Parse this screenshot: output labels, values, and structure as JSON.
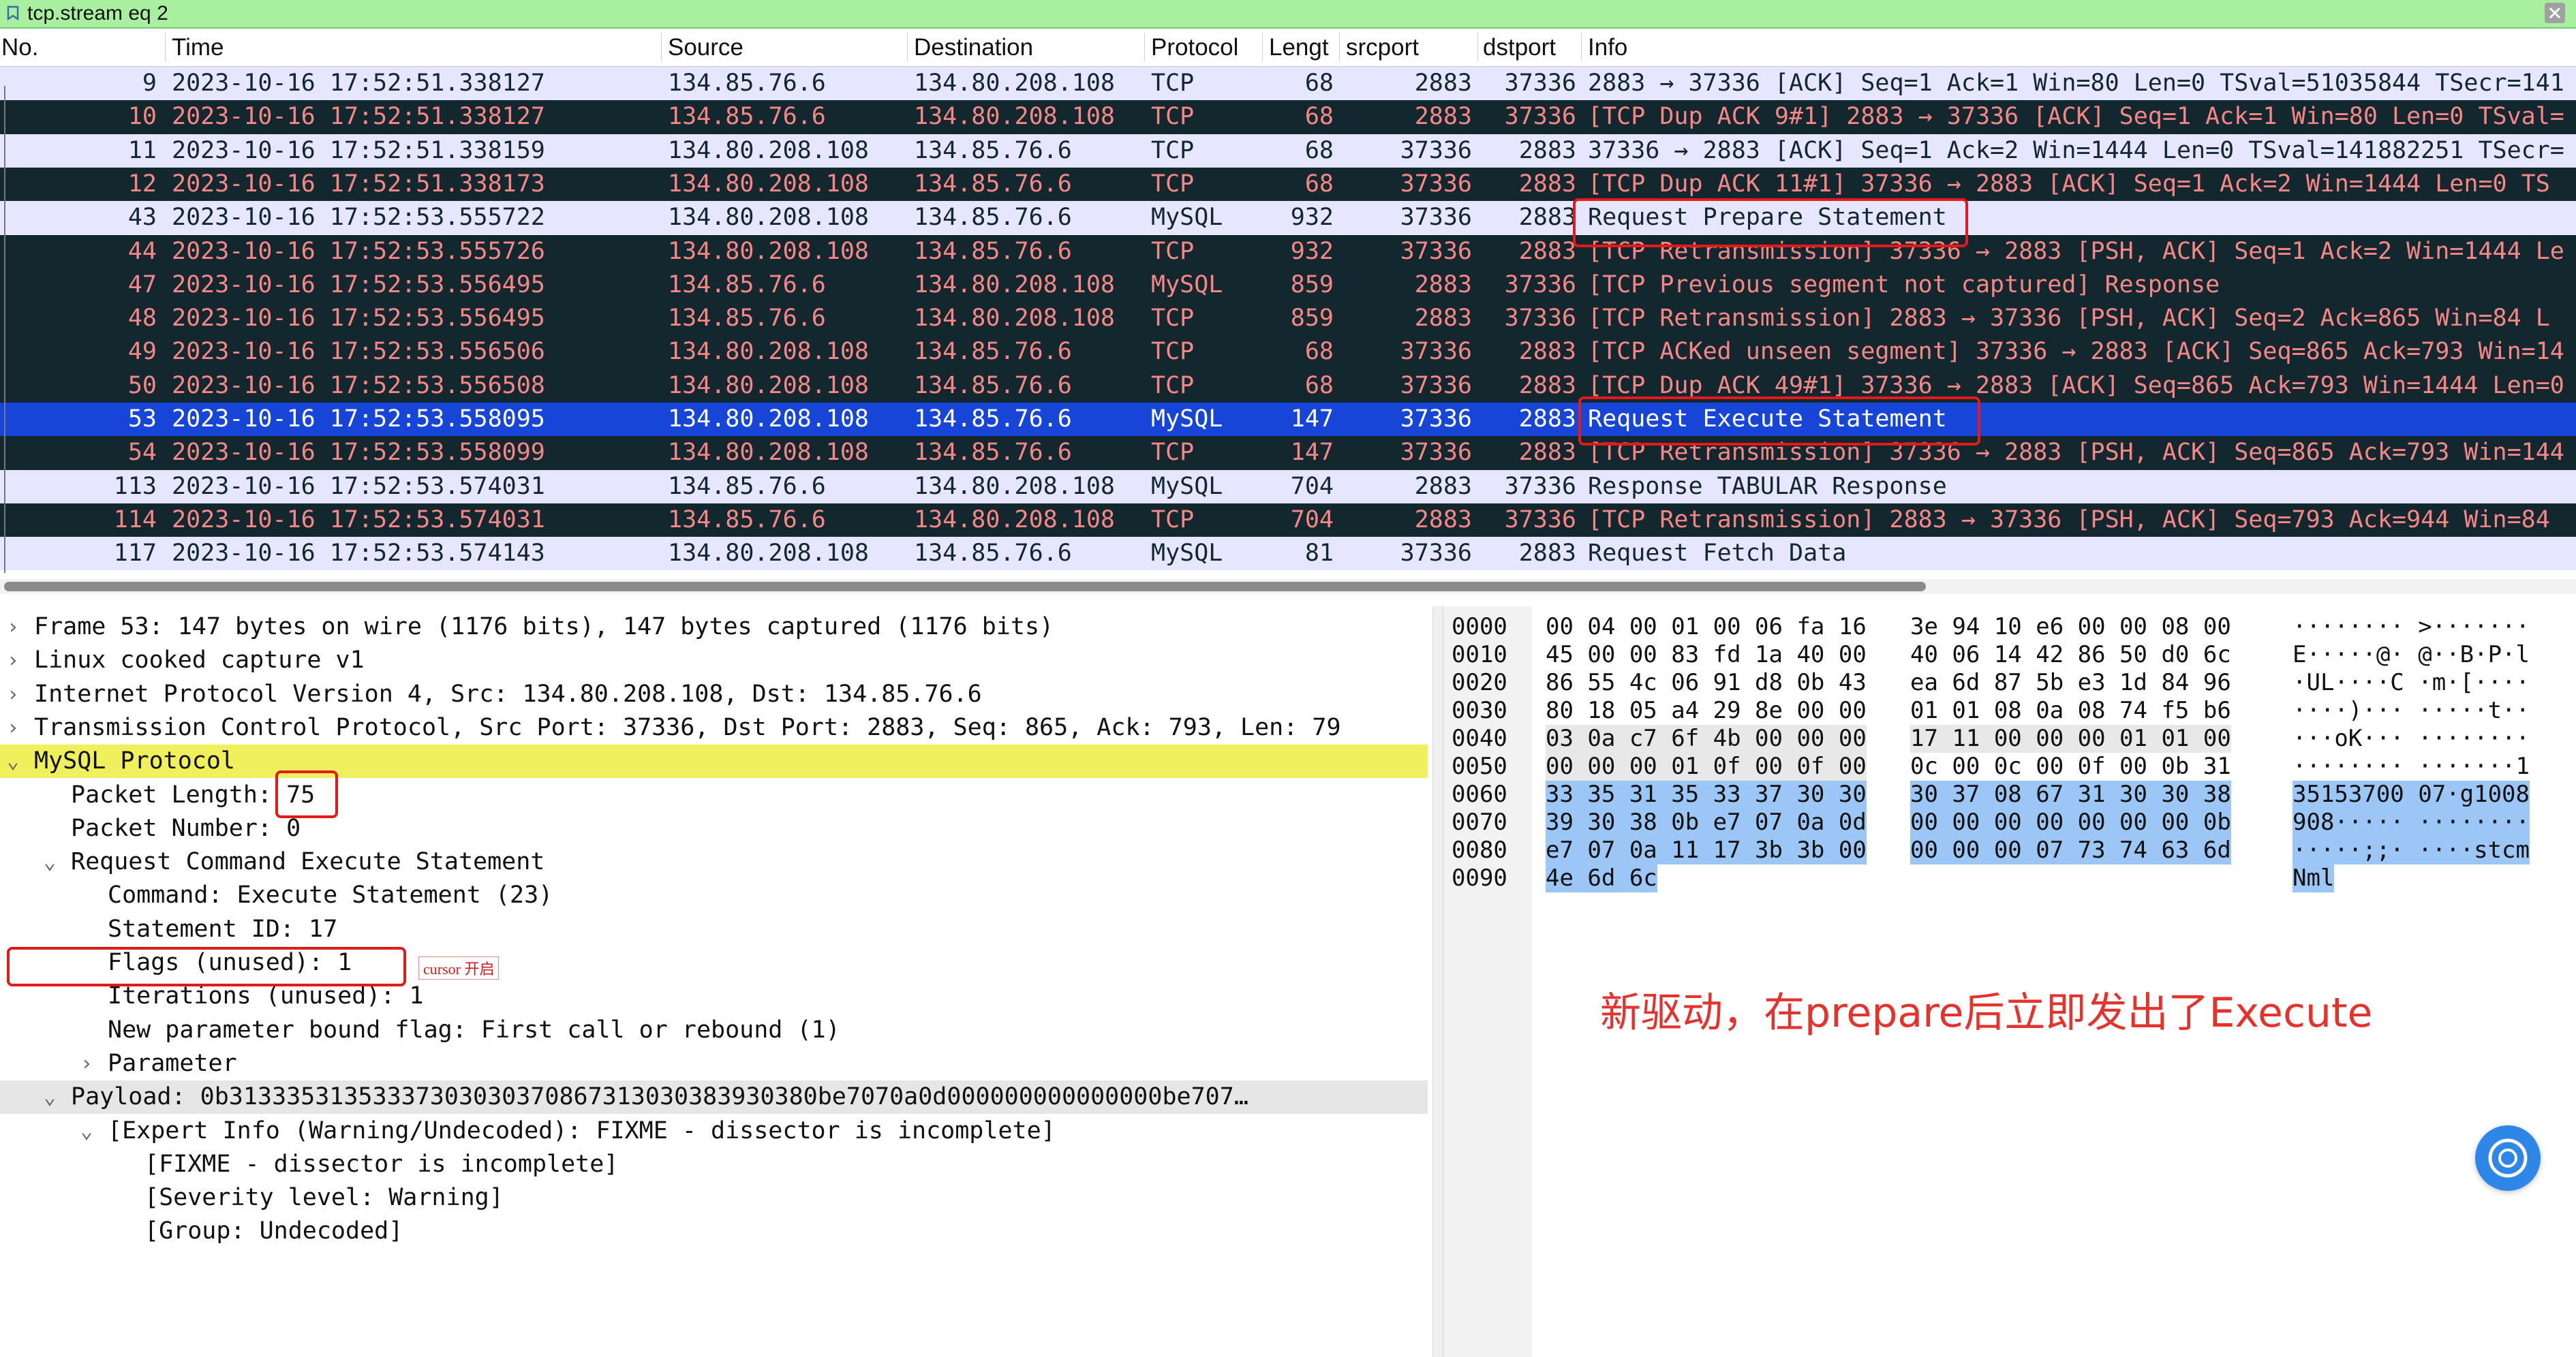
{
  "filter": {
    "value": "tcp.stream eq 2"
  },
  "columns": [
    "No.",
    "Time",
    "Source",
    "Destination",
    "Protocol",
    "Lengt",
    "srcport",
    "dstport",
    "Info"
  ],
  "packets": [
    {
      "no": "9",
      "time": "2023-10-16 17:52:51.338127",
      "src": "134.85.76.6",
      "dst": "134.80.208.108",
      "proto": "TCP",
      "len": "68",
      "sport": "2883",
      "dport": "37336",
      "info": "2883 → 37336 [ACK] Seq=1 Ack=1 Win=80 Len=0 TSval=51035844 TSecr=141",
      "style": "light"
    },
    {
      "no": "10",
      "time": "2023-10-16 17:52:51.338127",
      "src": "134.85.76.6",
      "dst": "134.80.208.108",
      "proto": "TCP",
      "len": "68",
      "sport": "2883",
      "dport": "37336",
      "info": "[TCP Dup ACK 9#1] 2883 → 37336 [ACK] Seq=1 Ack=1 Win=80 Len=0 TSval=",
      "style": "dark"
    },
    {
      "no": "11",
      "time": "2023-10-16 17:52:51.338159",
      "src": "134.80.208.108",
      "dst": "134.85.76.6",
      "proto": "TCP",
      "len": "68",
      "sport": "37336",
      "dport": "2883",
      "info": "37336 → 2883 [ACK] Seq=1 Ack=2 Win=1444 Len=0 TSval=141882251 TSecr=",
      "style": "light"
    },
    {
      "no": "12",
      "time": "2023-10-16 17:52:51.338173",
      "src": "134.80.208.108",
      "dst": "134.85.76.6",
      "proto": "TCP",
      "len": "68",
      "sport": "37336",
      "dport": "2883",
      "info": "[TCP Dup ACK 11#1] 37336 → 2883 [ACK] Seq=1 Ack=2 Win=1444 Len=0 TS",
      "style": "dark"
    },
    {
      "no": "43",
      "time": "2023-10-16 17:52:53.555722",
      "src": "134.80.208.108",
      "dst": "134.85.76.6",
      "proto": "MySQL",
      "len": "932",
      "sport": "37336",
      "dport": "2883",
      "info": "Request Prepare Statement",
      "style": "light"
    },
    {
      "no": "44",
      "time": "2023-10-16 17:52:53.555726",
      "src": "134.80.208.108",
      "dst": "134.85.76.6",
      "proto": "TCP",
      "len": "932",
      "sport": "37336",
      "dport": "2883",
      "info": "[TCP Retransmission] 37336 → 2883 [PSH, ACK] Seq=1 Ack=2 Win=1444 Le",
      "style": "dark"
    },
    {
      "no": "47",
      "time": "2023-10-16 17:52:53.556495",
      "src": "134.85.76.6",
      "dst": "134.80.208.108",
      "proto": "MySQL",
      "len": "859",
      "sport": "2883",
      "dport": "37336",
      "info": "[TCP Previous segment not captured] Response",
      "style": "dark"
    },
    {
      "no": "48",
      "time": "2023-10-16 17:52:53.556495",
      "src": "134.85.76.6",
      "dst": "134.80.208.108",
      "proto": "TCP",
      "len": "859",
      "sport": "2883",
      "dport": "37336",
      "info": "[TCP Retransmission] 2883 → 37336 [PSH, ACK] Seq=2 Ack=865 Win=84 L",
      "style": "dark"
    },
    {
      "no": "49",
      "time": "2023-10-16 17:52:53.556506",
      "src": "134.80.208.108",
      "dst": "134.85.76.6",
      "proto": "TCP",
      "len": "68",
      "sport": "37336",
      "dport": "2883",
      "info": "[TCP ACKed unseen segment] 37336 → 2883 [ACK] Seq=865 Ack=793 Win=14",
      "style": "dark"
    },
    {
      "no": "50",
      "time": "2023-10-16 17:52:53.556508",
      "src": "134.80.208.108",
      "dst": "134.85.76.6",
      "proto": "TCP",
      "len": "68",
      "sport": "37336",
      "dport": "2883",
      "info": "[TCP Dup ACK 49#1] 37336 → 2883 [ACK] Seq=865 Ack=793 Win=1444 Len=0",
      "style": "dark"
    },
    {
      "no": "53",
      "time": "2023-10-16 17:52:53.558095",
      "src": "134.80.208.108",
      "dst": "134.85.76.6",
      "proto": "MySQL",
      "len": "147",
      "sport": "37336",
      "dport": "2883",
      "info": "Request Execute Statement",
      "style": "sel"
    },
    {
      "no": "54",
      "time": "2023-10-16 17:52:53.558099",
      "src": "134.80.208.108",
      "dst": "134.85.76.6",
      "proto": "TCP",
      "len": "147",
      "sport": "37336",
      "dport": "2883",
      "info": "[TCP Retransmission] 37336 → 2883 [PSH, ACK] Seq=865 Ack=793 Win=144",
      "style": "dark"
    },
    {
      "no": "113",
      "time": "2023-10-16 17:52:53.574031",
      "src": "134.85.76.6",
      "dst": "134.80.208.108",
      "proto": "MySQL",
      "len": "704",
      "sport": "2883",
      "dport": "37336",
      "info": "Response TABULAR Response",
      "style": "light"
    },
    {
      "no": "114",
      "time": "2023-10-16 17:52:53.574031",
      "src": "134.85.76.6",
      "dst": "134.80.208.108",
      "proto": "TCP",
      "len": "704",
      "sport": "2883",
      "dport": "37336",
      "info": "[TCP Retransmission] 2883 → 37336 [PSH, ACK] Seq=793 Ack=944 Win=84",
      "style": "dark"
    },
    {
      "no": "117",
      "time": "2023-10-16 17:52:53.574143",
      "src": "134.80.208.108",
      "dst": "134.85.76.6",
      "proto": "MySQL",
      "len": "81",
      "sport": "37336",
      "dport": "2883",
      "info": "Request Fetch Data",
      "style": "light"
    }
  ],
  "details": [
    {
      "text": "Frame 53: 147 bytes on wire (1176 bits), 147 bytes captured (1176 bits)",
      "indent": 0,
      "chev": ">",
      "style": ""
    },
    {
      "text": "Linux cooked capture v1",
      "indent": 0,
      "chev": ">",
      "style": ""
    },
    {
      "text": "Internet Protocol Version 4, Src: 134.80.208.108, Dst: 134.85.76.6",
      "indent": 0,
      "chev": ">",
      "style": ""
    },
    {
      "text": "Transmission Control Protocol, Src Port: 37336, Dst Port: 2883, Seq: 865, Ack: 793, Len: 79",
      "indent": 0,
      "chev": ">",
      "style": ""
    },
    {
      "text": "MySQL Protocol",
      "indent": 0,
      "chev": "v",
      "style": "yellow"
    },
    {
      "text": "Packet Length: 75",
      "indent": 1,
      "chev": "",
      "style": ""
    },
    {
      "text": "Packet Number: 0",
      "indent": 1,
      "chev": "",
      "style": ""
    },
    {
      "text": "Request Command Execute Statement",
      "indent": 1,
      "chev": "v",
      "style": ""
    },
    {
      "text": "Command: Execute Statement (23)",
      "indent": 2,
      "chev": "",
      "style": ""
    },
    {
      "text": "Statement ID: 17",
      "indent": 2,
      "chev": "",
      "style": ""
    },
    {
      "text": "Flags (unused): 1",
      "indent": 2,
      "chev": "",
      "style": ""
    },
    {
      "text": "Iterations (unused): 1",
      "indent": 2,
      "chev": "",
      "style": ""
    },
    {
      "text": "New parameter bound flag: First call or rebound (1)",
      "indent": 2,
      "chev": "",
      "style": ""
    },
    {
      "text": "Parameter",
      "indent": 2,
      "chev": ">",
      "style": ""
    },
    {
      "text": "Payload: 0b31333531353337303030370867313030383930380be7070a0d000000000000000be707…",
      "indent": 1,
      "chev": "v",
      "style": "gray"
    },
    {
      "text": "[Expert Info (Warning/Undecoded): FIXME - dissector is incomplete]",
      "indent": 2,
      "chev": "v",
      "style": ""
    },
    {
      "text": "[FIXME - dissector is incomplete]",
      "indent": 3,
      "chev": "",
      "style": ""
    },
    {
      "text": "[Severity level: Warning]",
      "indent": 3,
      "chev": "",
      "style": ""
    },
    {
      "text": "[Group: Undecoded]",
      "indent": 3,
      "chev": "",
      "style": ""
    }
  ],
  "hex_rows": [
    {
      "offset": "0000",
      "a": "00 04 00 01 00 06 fa 16",
      "b": "3e 94 10 e6 00 00 08 00",
      "ascii": "········ >·······"
    },
    {
      "offset": "0010",
      "a": "45 00 00 83 fd 1a 40 00",
      "b": "40 06 14 42 86 50 d0 6c",
      "ascii": "E·····@· @··B·P·l"
    },
    {
      "offset": "0020",
      "a": "86 55 4c 06 91 d8 0b 43",
      "b": "ea 6d 87 5b e3 1d 84 96",
      "ascii": "·UL····C ·m·[····"
    },
    {
      "offset": "0030",
      "a": "80 18 05 a4 29 8e 00 00",
      "b": "01 01 08 0a 08 74 f5 b6",
      "ascii": "····)··· ·····t··"
    },
    {
      "offset": "0040",
      "a": "03 0a c7 6f 4b 00 00 00",
      "b": "17 11 00 00 00 01 01 00",
      "ascii": "···oK··· ········"
    },
    {
      "offset": "0050",
      "a": "00 00 00 01 0f 00 0f 00",
      "b": "0c 00 0c 00 0f 00 0b 31",
      "ascii": "········ ·······1"
    },
    {
      "offset": "0060",
      "a": "33 35 31 35 33 37 30 30",
      "b": "30 37 08 67 31 30 30 38",
      "ascii": "35153700 07·g1008"
    },
    {
      "offset": "0070",
      "a": "39 30 38 0b e7 07 0a 0d",
      "b": "00 00 00 00 00 00 00 0b",
      "ascii": "908····· ········"
    },
    {
      "offset": "0080",
      "a": "e7 07 0a 11 17 3b 3b 00",
      "b": "00 00 00 07 73 74 63 6d",
      "ascii": "·····;;· ····stcm"
    },
    {
      "offset": "0090",
      "a": "4e 6d 6c",
      "b": "",
      "ascii": "Nml"
    }
  ],
  "annotations": {
    "cursor_note": "cursor 开启",
    "main_note": "新驱动，在prepare后立即发出了Execute"
  },
  "colors": {
    "filter_bg": "#a8f0a0",
    "row_light": "#e7e6ff",
    "row_dark": "#12272e",
    "row_dark_text": "#f78787",
    "row_selected": "#1745d8",
    "highlight_yellow": "#f0ef5c",
    "hex_highlight": "#9cc6f5",
    "annotation_red": "#e21a1a"
  },
  "icons": [
    "bookmark-icon",
    "clear-filter-icon",
    "expand-chevron-icon",
    "help-bot-icon"
  ]
}
